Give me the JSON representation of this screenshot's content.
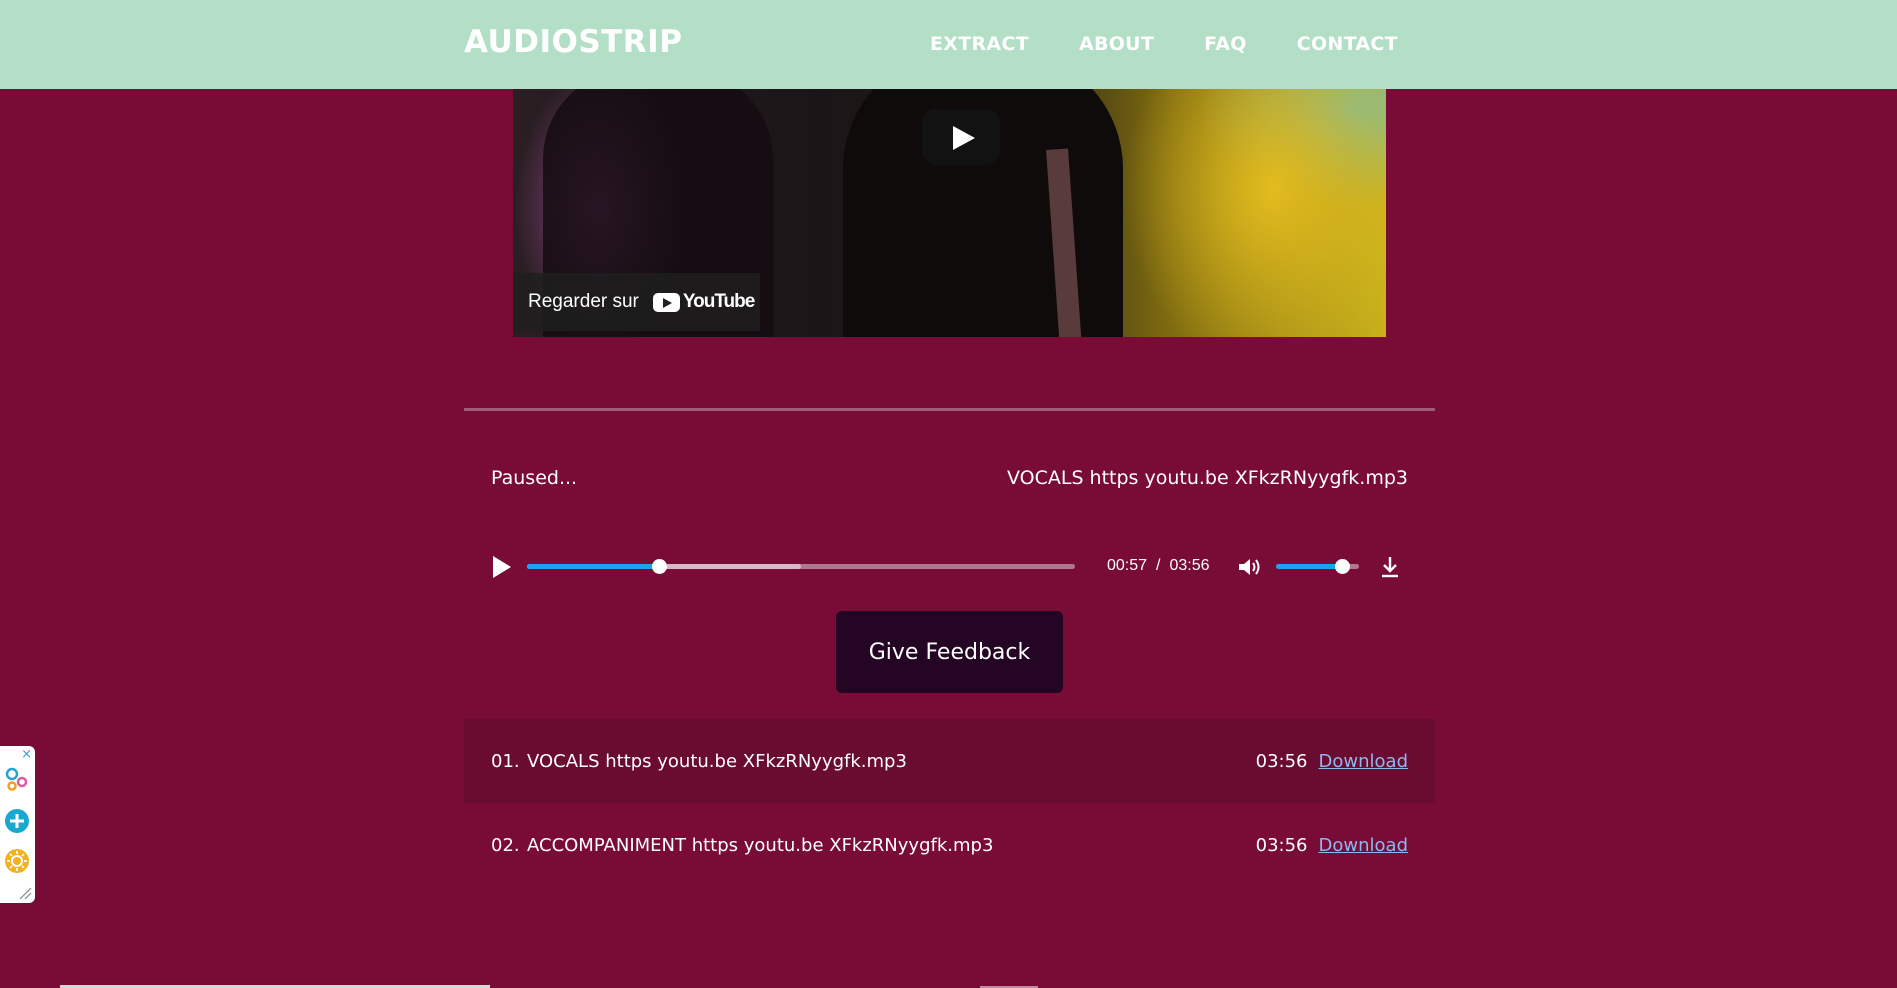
{
  "header": {
    "brand": "AUDIOSTRIP",
    "nav": [
      "EXTRACT",
      "ABOUT",
      "FAQ",
      "CONTACT"
    ]
  },
  "video": {
    "watch_on": "Regarder sur",
    "platform": "YouTube"
  },
  "player": {
    "status": "Paused...",
    "current_track": "VOCALS https youtu.be XFkzRNyygfk.mp3",
    "elapsed": "00:57",
    "separator": "/",
    "duration": "03:56",
    "progress_fraction": 0.24,
    "buffered_fraction": 0.5,
    "volume_fraction": 0.8
  },
  "feedback_label": "Give Feedback",
  "tracks": [
    {
      "num": "01.",
      "title": "VOCALS https youtu.be XFkzRNyygfk.mp3",
      "duration": "03:56",
      "link": "Download"
    },
    {
      "num": "02.",
      "title": "ACCOMPANIMENT https youtu.be XFkzRNyygfk.mp3",
      "duration": "03:56",
      "link": "Download"
    }
  ],
  "widget": {
    "close": "×"
  },
  "colors": {
    "background": "#780c37",
    "header": "#b3dfc6",
    "accent": "#1aa3f0",
    "button": "#240523"
  }
}
